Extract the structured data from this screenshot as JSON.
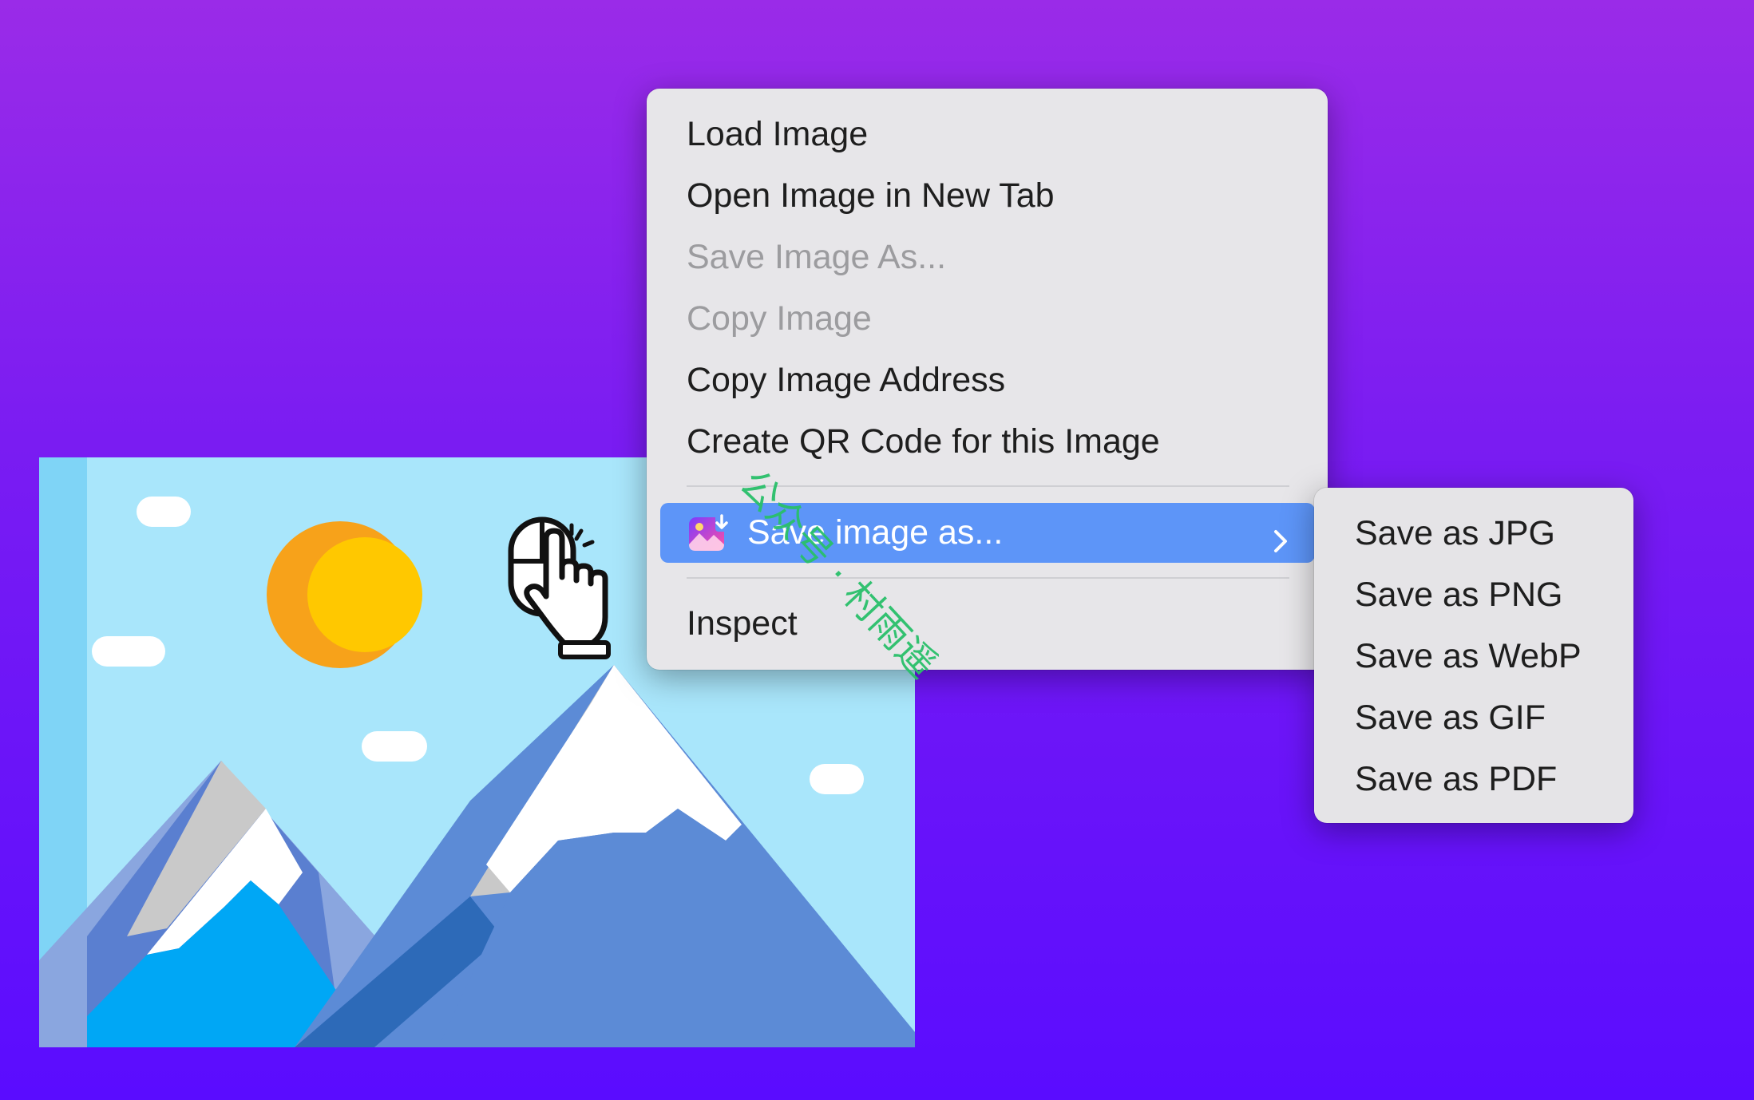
{
  "context_menu": {
    "items": [
      {
        "label": "Load Image",
        "enabled": true
      },
      {
        "label": "Open Image in New Tab",
        "enabled": true
      },
      {
        "label": "Save Image As...",
        "enabled": false
      },
      {
        "label": "Copy Image",
        "enabled": false
      },
      {
        "label": "Copy Image Address",
        "enabled": true
      },
      {
        "label": "Create QR Code for this Image",
        "enabled": true
      }
    ],
    "highlighted": {
      "label": "Save image as...",
      "icon": "image-download-icon",
      "has_submenu": true
    },
    "footer_item": {
      "label": "Inspect"
    }
  },
  "submenu": {
    "items": [
      {
        "label": "Save as JPG"
      },
      {
        "label": "Save as PNG"
      },
      {
        "label": "Save as WebP"
      },
      {
        "label": "Save as GIF"
      },
      {
        "label": "Save as PDF"
      }
    ]
  },
  "watermark": {
    "text": "公众号 · 村雨遥"
  },
  "colors": {
    "background_top": "#9a2be8",
    "background_bottom": "#5a0cff",
    "menu_bg": "#e7e6e9",
    "highlight": "#5d95f8",
    "disabled_text": "#9c9c9f",
    "sky": "#a9e6fb",
    "sun": "#ffc800",
    "mountain": "#5c8bd6"
  }
}
